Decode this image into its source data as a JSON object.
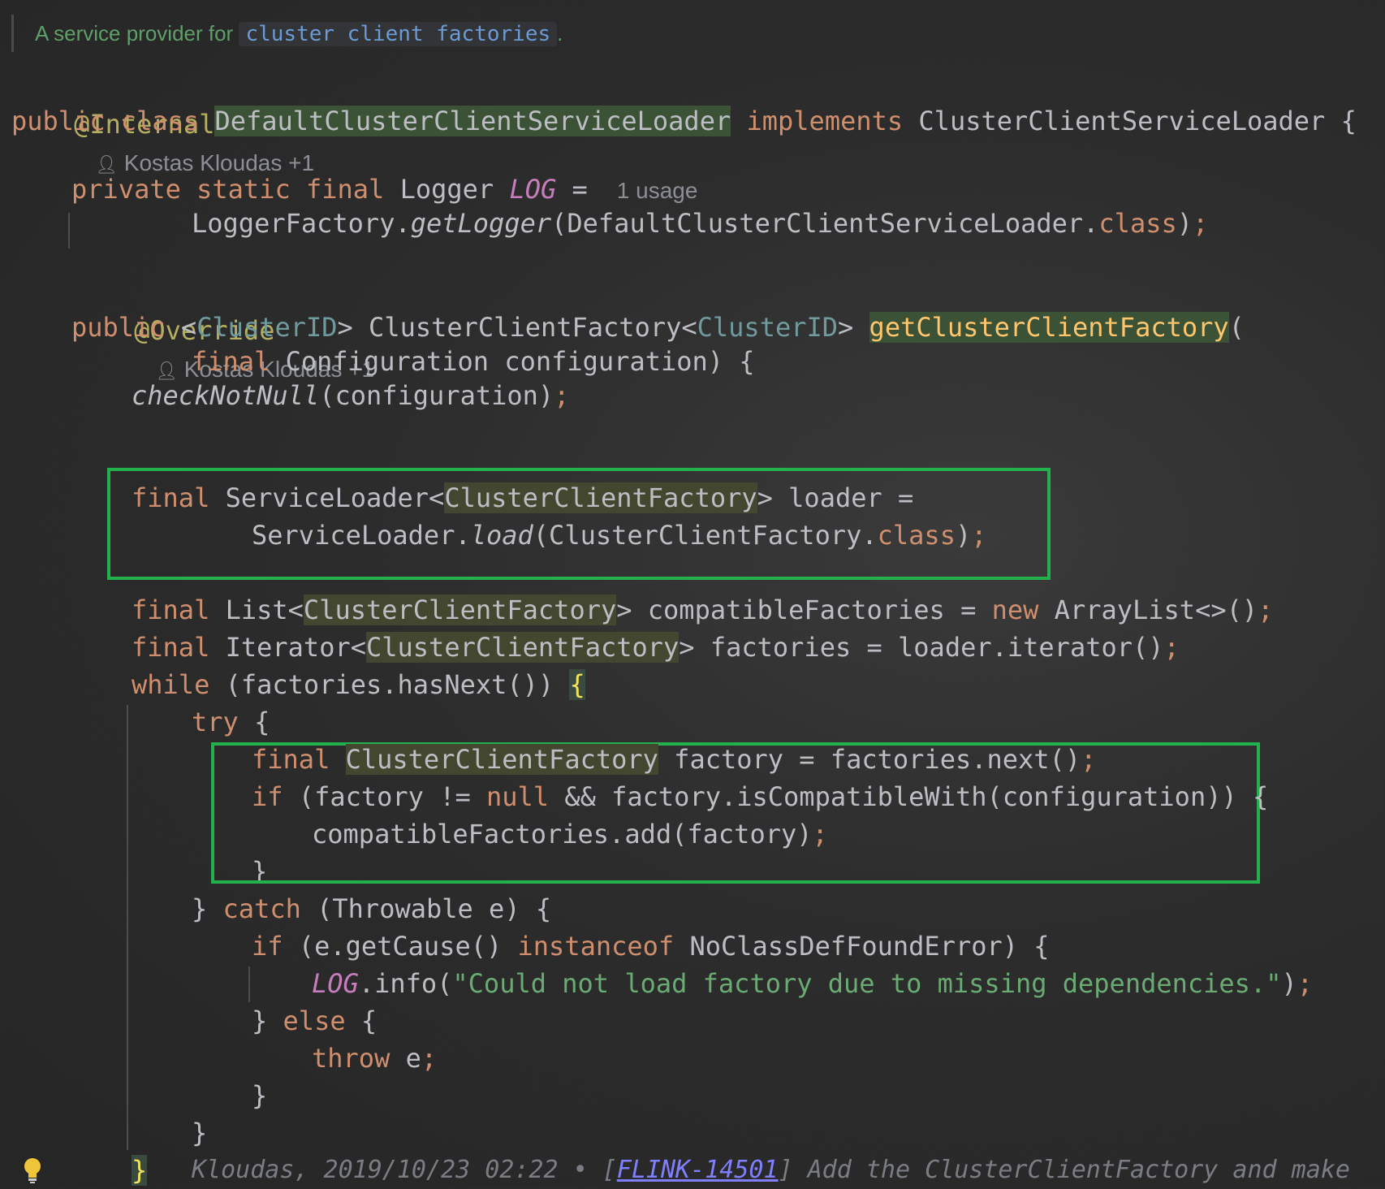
{
  "doc_comment": {
    "text_before": "A service provider for",
    "code_link": "cluster client factories",
    "text_after": "."
  },
  "class_header": {
    "annotation": "@Internal",
    "author": "Kostas Kloudas +1",
    "decl_public": "public",
    "decl_class": "class",
    "class_name": "DefaultClusterClientServiceLoader",
    "implements_kw": "implements",
    "interface_name": "ClusterClientServiceLoader",
    "open_brace": "{"
  },
  "logger_field": {
    "modifiers": "private static final",
    "type": "Logger",
    "name": "LOG",
    "equals": "=",
    "usage_hint": "1 usage",
    "init_prefix": "LoggerFactory.",
    "init_method": "getLogger",
    "init_args": "(DefaultClusterClientServiceLoader.",
    "init_class_kw": "class",
    "init_close": ")",
    "semicolon": ";"
  },
  "method": {
    "annotation": "@Override",
    "author": "Kostas Kloudas +1",
    "public_kw": "public",
    "lt": "<",
    "type_param": "ClusterID",
    "gt": "> ",
    "return_type": "ClusterClientFactory",
    "return_generic": "ClusterID",
    "name": "getClusterClientFactory",
    "open_paren": "(",
    "param_final": "final",
    "param_decl": " Configuration configuration) {",
    "check_call": "checkNotNull",
    "check_args": "(configuration)",
    "semicolon": ";"
  },
  "code_lines": {
    "loader_decl_final": "final",
    "loader_decl_type": " ServiceLoader<",
    "loader_decl_generic": "ClusterClientFactory",
    "loader_decl_rest": "> loader =",
    "loader_init_prefix": "ServiceLoader.",
    "loader_init_method": "load",
    "loader_init_args": "(ClusterClientFactory.",
    "loader_init_class": "class",
    "loader_init_close": ")",
    "list_final": "final",
    "list_type": " List<",
    "list_generic": "ClusterClientFactory",
    "list_rest": "> compatibleFactories = ",
    "list_new": "new",
    "list_init": " ArrayList<>()",
    "iter_final": "final",
    "iter_type": " Iterator<",
    "iter_generic": "ClusterClientFactory",
    "iter_rest": "> factories = loader.iterator()",
    "while_kw": "while",
    "while_cond": " (factories.hasNext()) ",
    "while_brace": "{",
    "try_kw": "try",
    "try_brace": " {",
    "factory_final": "final",
    "factory_type": "ClusterClientFactory",
    "factory_rest": " factory = factories.next()",
    "if_kw": "if",
    "if_cond_a": " (factory != ",
    "if_null": "null",
    "if_cond_b": " && factory.isCompatibleWith(configuration)) {",
    "add_call": "compatibleFactories.add(factory)",
    "close_if": "}",
    "catch_close": "} ",
    "catch_kw": "catch",
    "catch_rest": " (Throwable e) {",
    "if2_kw": "if",
    "if2_a": " (e.getCause() ",
    "instanceof_kw": "instanceof",
    "if2_b": " NoClassDefFoundError) {",
    "log_field": "LOG",
    "log_call": ".info(",
    "log_msg": "\"Could not load factory due to missing dependencies.\"",
    "log_close": ")",
    "else_close": "} ",
    "else_kw": "else",
    "else_brace": " {",
    "throw_kw": "throw",
    "throw_rest": " e",
    "close_else": "}",
    "close_catch": "}",
    "close_while": "}"
  },
  "blame": {
    "text": "Kloudas, 2019/10/23 02:22 • [",
    "issue": "FLINK-14501",
    "after": "] Add the ClusterClientFactory and make"
  },
  "colors": {
    "highlight_box": "#22b14c",
    "keyword": "#cf8e6d",
    "annotation": "#b3ae60",
    "string": "#6aab73"
  }
}
